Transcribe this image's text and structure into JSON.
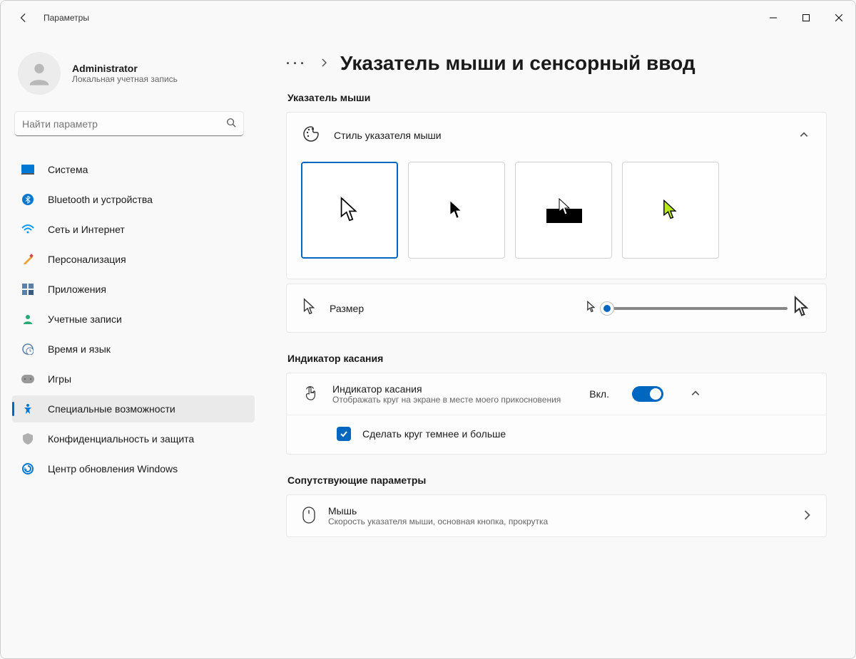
{
  "window": {
    "title": "Параметры"
  },
  "account": {
    "name": "Administrator",
    "subtitle": "Локальная учетная запись"
  },
  "search": {
    "placeholder": "Найти параметр"
  },
  "nav": {
    "items": [
      {
        "label": "Система"
      },
      {
        "label": "Bluetooth и устройства"
      },
      {
        "label": "Сеть и Интернет"
      },
      {
        "label": "Персонализация"
      },
      {
        "label": "Приложения"
      },
      {
        "label": "Учетные записи"
      },
      {
        "label": "Время и язык"
      },
      {
        "label": "Игры"
      },
      {
        "label": "Специальные возможности"
      },
      {
        "label": "Конфиденциальность и защита"
      },
      {
        "label": "Центр обновления Windows"
      }
    ]
  },
  "page": {
    "title": "Указатель мыши и сенсорный ввод"
  },
  "sections": {
    "pointer": "Указатель мыши",
    "touch": "Индикатор касания",
    "related": "Сопутствующие параметры"
  },
  "pointerStyle": {
    "title": "Стиль указателя мыши"
  },
  "size": {
    "label": "Размер"
  },
  "touch": {
    "title": "Индикатор касания",
    "subtitle": "Отображать круг на экране в месте моего прикосновения",
    "state": "Вкл.",
    "checkboxLabel": "Сделать круг темнее и больше"
  },
  "related": {
    "mouse": {
      "title": "Мышь",
      "subtitle": "Скорость указателя мыши, основная кнопка, прокрутка"
    }
  }
}
